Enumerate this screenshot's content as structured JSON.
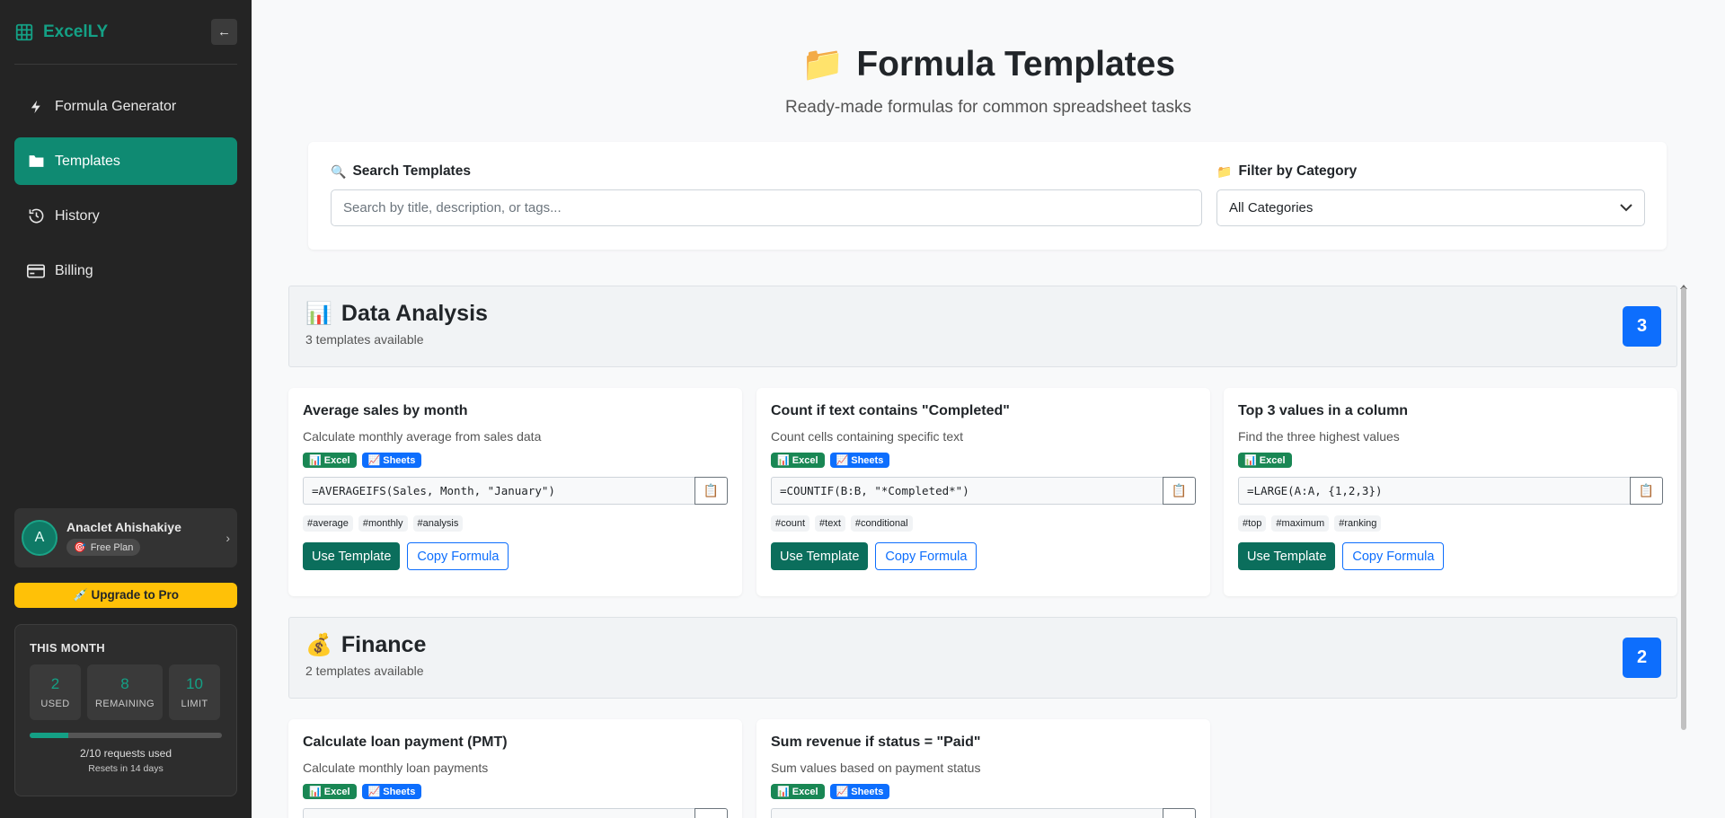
{
  "app": {
    "name": "ExcelLY",
    "collapse_label": "←"
  },
  "nav": [
    {
      "label": "Formula Generator",
      "icon": "lightning-icon",
      "active": false
    },
    {
      "label": "Templates",
      "icon": "folder-icon",
      "active": true
    },
    {
      "label": "History",
      "icon": "history-icon",
      "active": false
    },
    {
      "label": "Billing",
      "icon": "credit-card-icon",
      "active": false
    }
  ],
  "user": {
    "initial": "A",
    "name": "Anaclet Ahishakiye",
    "plan": "Free Plan",
    "plan_icon": "🎯",
    "chevron": "›"
  },
  "upgrade": {
    "label": "💉 Upgrade to Pro"
  },
  "usage": {
    "title": "THIS MONTH",
    "used": "2",
    "used_label": "USED",
    "remaining": "8",
    "remaining_label": "REMAINING",
    "limit": "10",
    "limit_label": "LIMIT",
    "progress_fraction": 0.2,
    "summary": "2/10 requests used",
    "reset": "Resets in 14 days"
  },
  "page": {
    "emoji": "📁",
    "title": "Formula Templates",
    "subtitle": "Ready-made formulas for common spreadsheet tasks"
  },
  "search": {
    "icon": "🔍",
    "label": "Search Templates",
    "placeholder": "Search by title, description, or tags..."
  },
  "filter": {
    "icon": "📁",
    "label": "Filter by Category",
    "value": "All Categories"
  },
  "sections": [
    {
      "emoji": "📊",
      "title": "Data Analysis",
      "subtitle": "3 templates available",
      "count": "3",
      "cards": [
        {
          "title": "Average sales by month",
          "desc": "Calculate monthly average from sales data",
          "badges": [
            "📊 Excel",
            "📈 Sheets"
          ],
          "formula": "=AVERAGEIFS(Sales, Month, \"January\")",
          "tags": [
            "#average",
            "#monthly",
            "#analysis"
          ]
        },
        {
          "title": "Count if text contains \"Completed\"",
          "desc": "Count cells containing specific text",
          "badges": [
            "📊 Excel",
            "📈 Sheets"
          ],
          "formula": "=COUNTIF(B:B, \"*Completed*\")",
          "tags": [
            "#count",
            "#text",
            "#conditional"
          ]
        },
        {
          "title": "Top 3 values in a column",
          "desc": "Find the three highest values",
          "badges": [
            "📊 Excel"
          ],
          "formula": "=LARGE(A:A, {1,2,3})",
          "tags": [
            "#top",
            "#maximum",
            "#ranking"
          ]
        }
      ]
    },
    {
      "emoji": "💰",
      "title": "Finance",
      "subtitle": "2 templates available",
      "count": "2",
      "cards": [
        {
          "title": "Calculate loan payment (PMT)",
          "desc": "Calculate monthly loan payments",
          "badges": [
            "📊 Excel",
            "📈 Sheets"
          ]
        },
        {
          "title": "Sum revenue if status = \"Paid\"",
          "desc": "Sum values based on payment status",
          "badges": [
            "📊 Excel",
            "📈 Sheets"
          ]
        }
      ]
    }
  ],
  "card_actions": {
    "use": "Use Template",
    "copy": "Copy Formula",
    "copy_icon": "📋"
  },
  "colors": {
    "accent": "#14a085",
    "active_nav": "#0f8a72",
    "primary": "#0d6efd",
    "use_btn": "#0b6e5c",
    "upgrade": "#ffc107",
    "excel": "#198754"
  }
}
